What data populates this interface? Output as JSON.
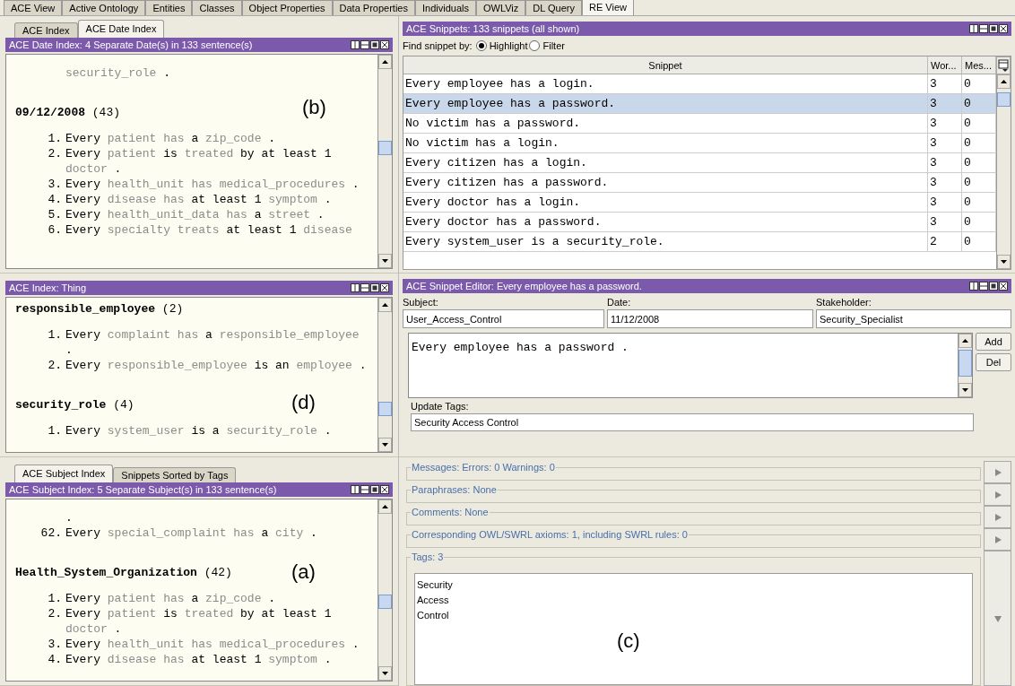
{
  "main_tabs": [
    {
      "label": "ACE View",
      "selected": false
    },
    {
      "label": "Active Ontology",
      "selected": false
    },
    {
      "label": "Entities",
      "selected": false
    },
    {
      "label": "Classes",
      "selected": false
    },
    {
      "label": "Object Properties",
      "selected": false
    },
    {
      "label": "Data Properties",
      "selected": false
    },
    {
      "label": "Individuals",
      "selected": false
    },
    {
      "label": "OWLViz",
      "selected": false
    },
    {
      "label": "DL Query",
      "selected": false
    },
    {
      "label": "RE View",
      "selected": true
    }
  ],
  "index_panels": [
    {
      "tabs": [
        {
          "label": "ACE Index",
          "selected": false
        },
        {
          "label": "ACE Date Index",
          "selected": true
        }
      ],
      "title": "ACE Date Index: 4 Separate Date(s) in 133 sentence(s)",
      "annotation": "(b)",
      "entries": [
        {
          "kind": "continuation",
          "parts": [
            {
              "text": "security_role",
              "kind": "term"
            },
            {
              "text": " .",
              "kind": "keyword"
            }
          ]
        },
        {
          "kind": "heading",
          "text": "**09/12/2008** (43)"
        },
        {
          "kind": "sentence",
          "number": "1.",
          "parts": [
            {
              "text": "Every ",
              "kind": "keyword"
            },
            {
              "text": "patient has ",
              "kind": "term"
            },
            {
              "text": "a ",
              "kind": "keyword"
            },
            {
              "text": "zip_code",
              "kind": "term"
            },
            {
              "text": " .",
              "kind": "keyword"
            }
          ]
        },
        {
          "kind": "sentence",
          "number": "2.",
          "parts": [
            {
              "text": "Every ",
              "kind": "keyword"
            },
            {
              "text": "patient ",
              "kind": "term"
            },
            {
              "text": "is ",
              "kind": "keyword"
            },
            {
              "text": "treated ",
              "kind": "term"
            },
            {
              "text": "by at least 1 ",
              "kind": "keyword"
            },
            {
              "text": "doctor",
              "kind": "term"
            },
            {
              "text": " .",
              "kind": "keyword"
            }
          ]
        },
        {
          "kind": "sentence",
          "number": "3.",
          "parts": [
            {
              "text": "Every ",
              "kind": "keyword"
            },
            {
              "text": "health_unit has medical_procedures",
              "kind": "term"
            },
            {
              "text": " .",
              "kind": "keyword"
            }
          ]
        },
        {
          "kind": "sentence",
          "number": "4.",
          "parts": [
            {
              "text": "Every ",
              "kind": "keyword"
            },
            {
              "text": "disease has ",
              "kind": "term"
            },
            {
              "text": "at least 1 ",
              "kind": "keyword"
            },
            {
              "text": "symptom",
              "kind": "term"
            },
            {
              "text": " .",
              "kind": "keyword"
            }
          ]
        },
        {
          "kind": "sentence",
          "number": "5.",
          "parts": [
            {
              "text": "Every ",
              "kind": "keyword"
            },
            {
              "text": "health_unit_data has ",
              "kind": "term"
            },
            {
              "text": "a ",
              "kind": "keyword"
            },
            {
              "text": "street",
              "kind": "term"
            },
            {
              "text": " .",
              "kind": "keyword"
            }
          ]
        },
        {
          "kind": "sentence",
          "number": "6.",
          "parts": [
            {
              "text": "Every ",
              "kind": "keyword"
            },
            {
              "text": "specialty treats ",
              "kind": "term"
            },
            {
              "text": "at least 1 ",
              "kind": "keyword"
            },
            {
              "text": "disease",
              "kind": "term"
            }
          ]
        }
      ]
    },
    {
      "title": "ACE Index: Thing",
      "annotation": "(d)",
      "entries": [
        {
          "kind": "heading",
          "text": "**responsible_employee** (2)"
        },
        {
          "kind": "sentence",
          "number": "1.",
          "parts": [
            {
              "text": "Every ",
              "kind": "keyword"
            },
            {
              "text": "complaint has ",
              "kind": "term"
            },
            {
              "text": "a ",
              "kind": "keyword"
            },
            {
              "text": "responsible_employee",
              "kind": "term"
            },
            {
              "text": " .",
              "kind": "keyword"
            }
          ]
        },
        {
          "kind": "sentence",
          "number": "2.",
          "parts": [
            {
              "text": "Every ",
              "kind": "keyword"
            },
            {
              "text": "responsible_employee ",
              "kind": "term"
            },
            {
              "text": "is an ",
              "kind": "keyword"
            },
            {
              "text": "employee",
              "kind": "term"
            },
            {
              "text": " .",
              "kind": "keyword"
            }
          ]
        },
        {
          "kind": "heading",
          "text": "**security_role** (4)"
        },
        {
          "kind": "sentence",
          "number": "1.",
          "parts": [
            {
              "text": "Every ",
              "kind": "keyword"
            },
            {
              "text": "system_user ",
              "kind": "term"
            },
            {
              "text": "is a ",
              "kind": "keyword"
            },
            {
              "text": "security_role",
              "kind": "term"
            },
            {
              "text": " .",
              "kind": "keyword"
            }
          ]
        }
      ]
    },
    {
      "tabs": [
        {
          "label": "ACE Subject Index",
          "selected": true
        },
        {
          "label": "Snippets Sorted by Tags",
          "selected": false
        }
      ],
      "title": "ACE Subject Index: 5 Separate Subject(s) in 133 sentence(s)",
      "annotation": "(a)",
      "entries": [
        {
          "kind": "continuation",
          "parts": [
            {
              "text": ".",
              "kind": "keyword"
            }
          ]
        },
        {
          "kind": "sentence",
          "number": "62.",
          "parts": [
            {
              "text": "Every ",
              "kind": "keyword"
            },
            {
              "text": "special_complaint has ",
              "kind": "term"
            },
            {
              "text": "a ",
              "kind": "keyword"
            },
            {
              "text": "city",
              "kind": "term"
            },
            {
              "text": " .",
              "kind": "keyword"
            }
          ]
        },
        {
          "kind": "heading",
          "text": "**Health_System_Organization** (42)"
        },
        {
          "kind": "sentence",
          "number": "1.",
          "parts": [
            {
              "text": "Every ",
              "kind": "keyword"
            },
            {
              "text": "patient has ",
              "kind": "term"
            },
            {
              "text": "a ",
              "kind": "keyword"
            },
            {
              "text": "zip_code",
              "kind": "term"
            },
            {
              "text": " .",
              "kind": "keyword"
            }
          ]
        },
        {
          "kind": "sentence",
          "number": "2.",
          "parts": [
            {
              "text": "Every ",
              "kind": "keyword"
            },
            {
              "text": "patient ",
              "kind": "term"
            },
            {
              "text": "is ",
              "kind": "keyword"
            },
            {
              "text": "treated ",
              "kind": "term"
            },
            {
              "text": "by at least 1 ",
              "kind": "keyword"
            },
            {
              "text": "doctor",
              "kind": "term"
            },
            {
              "text": " .",
              "kind": "keyword"
            }
          ]
        },
        {
          "kind": "sentence",
          "number": "3.",
          "parts": [
            {
              "text": "Every ",
              "kind": "keyword"
            },
            {
              "text": "health_unit has medical_procedures",
              "kind": "term"
            },
            {
              "text": " .",
              "kind": "keyword"
            }
          ]
        },
        {
          "kind": "sentence",
          "number": "4.",
          "parts": [
            {
              "text": "Every ",
              "kind": "keyword"
            },
            {
              "text": "disease has ",
              "kind": "term"
            },
            {
              "text": "at least 1 ",
              "kind": "keyword"
            },
            {
              "text": "symptom",
              "kind": "term"
            },
            {
              "text": " .",
              "kind": "keyword"
            }
          ]
        }
      ]
    }
  ],
  "snippets": {
    "title": "ACE Snippets: 133 snippets (all shown)",
    "find_label": "Find snippet by:",
    "options": [
      {
        "label": "Highlight",
        "selected": true
      },
      {
        "label": "Filter",
        "selected": false
      }
    ],
    "columns": [
      "Snippet",
      "Wor...",
      "Mes..."
    ],
    "rows": [
      {
        "cells": [
          "Every employee has a login.",
          "3",
          "0"
        ],
        "selected": false
      },
      {
        "cells": [
          "Every employee has a password.",
          "3",
          "0"
        ],
        "selected": true
      },
      {
        "cells": [
          "No victim has a password.",
          "3",
          "0"
        ],
        "selected": false
      },
      {
        "cells": [
          "No victim has a login.",
          "3",
          "0"
        ],
        "selected": false
      },
      {
        "cells": [
          "Every citizen has a login.",
          "3",
          "0"
        ],
        "selected": false
      },
      {
        "cells": [
          "Every citizen has a password.",
          "3",
          "0"
        ],
        "selected": false
      },
      {
        "cells": [
          "Every doctor has a login.",
          "3",
          "0"
        ],
        "selected": false
      },
      {
        "cells": [
          "Every doctor has a password.",
          "3",
          "0"
        ],
        "selected": false
      },
      {
        "cells": [
          "Every system_user is a security_role.",
          "2",
          "0"
        ],
        "selected": false
      }
    ]
  },
  "editor": {
    "title": "ACE Snippet Editor: Every employee has a password.",
    "fields": [
      {
        "label": "Subject:",
        "value": "User_Access_Control"
      },
      {
        "label": "Date:",
        "value": "11/12/2008"
      },
      {
        "label": "Stakeholder:",
        "value": "Security_Specialist"
      }
    ],
    "sentence": "Every employee has a password .",
    "buttons": [
      "Add",
      "Del"
    ],
    "tags_label": "Update Tags:",
    "tags_value": "Security Access Control"
  },
  "details": {
    "annotation": "(c)",
    "sections": [
      {
        "label": "Messages: Errors: 0  Warnings: 0",
        "expanded": false
      },
      {
        "label": "Paraphrases: None",
        "expanded": false
      },
      {
        "label": "Comments: None",
        "expanded": false
      },
      {
        "label": "Corresponding OWL/SWRL axioms: 1, including SWRL rules: 0",
        "expanded": false
      },
      {
        "label": "Tags: 3",
        "expanded": true,
        "items": [
          "Security",
          "Access",
          "Control"
        ]
      }
    ]
  }
}
